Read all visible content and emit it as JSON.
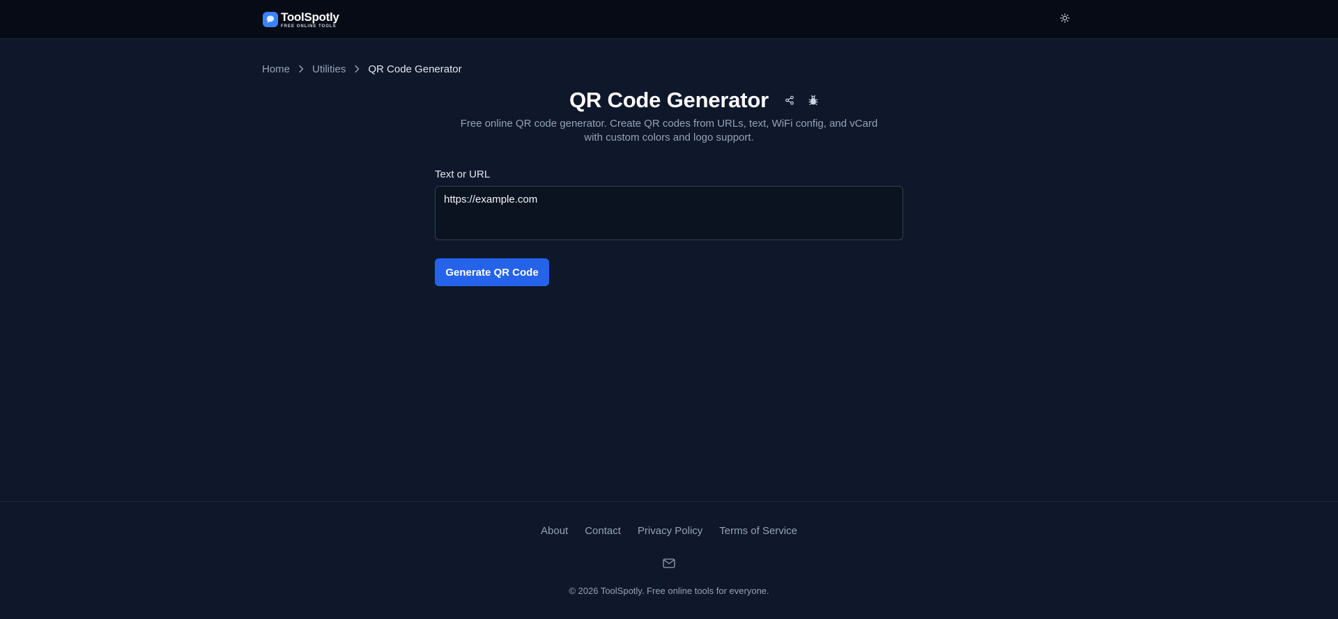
{
  "header": {
    "brand_name": "ToolSpotly",
    "brand_tagline": "FREE ONLINE TOOLS",
    "logo_icon": "chat-bubble-icon",
    "theme_toggle_icon": "sun-icon"
  },
  "breadcrumb": {
    "items": [
      {
        "label": "Home"
      },
      {
        "label": "Utilities"
      },
      {
        "label": "QR Code Generator"
      }
    ],
    "separator_icon": "chevron-right-icon"
  },
  "page": {
    "title": "QR Code Generator",
    "subtitle": "Free online QR code generator. Create QR codes from URLs, text, WiFi config, and vCard with custom colors and logo support.",
    "actions": [
      {
        "icon": "share-icon"
      },
      {
        "icon": "bug-icon"
      }
    ]
  },
  "form": {
    "input_label": "Text or URL",
    "input_value": "https://example.com",
    "generate_label": "Generate QR Code"
  },
  "footer": {
    "links": [
      {
        "label": "About"
      },
      {
        "label": "Contact"
      },
      {
        "label": "Privacy Policy"
      },
      {
        "label": "Terms of Service"
      }
    ],
    "mail_icon": "mail-icon",
    "copyright": "© 2026 ToolSpotly. Free online tools for everyone."
  },
  "colors": {
    "background": "#0f172a",
    "header_background": "#070b16",
    "accent": "#2563eb",
    "logo": "#3b82f6"
  }
}
